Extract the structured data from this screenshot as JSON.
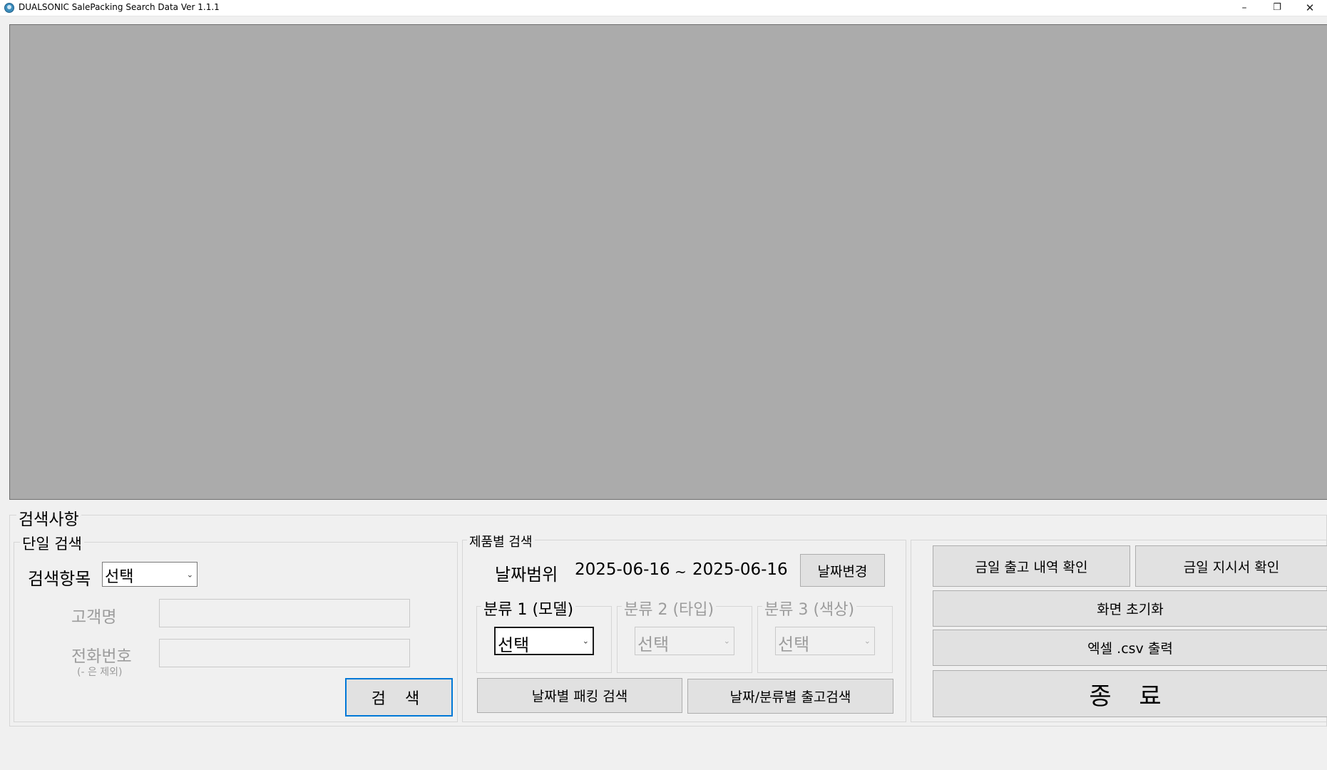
{
  "window": {
    "title": "DUALSONIC SalePacking Search Data Ver 1.1.1",
    "min_glyph": "–",
    "max_glyph": "❐",
    "close_glyph": "✕"
  },
  "search_panel": {
    "title": "검색사항",
    "single": {
      "title": "단일 검색",
      "search_item_label": "검색항목",
      "search_item_value": "선택",
      "customer_label": "고객명",
      "customer_value": "",
      "phone_label": "전화번호",
      "phone_hint": "(- 은 제외)",
      "phone_value": "",
      "search_button": "검 색"
    },
    "product": {
      "title": "제품별 검색",
      "date_range_label": "날짜범위",
      "date_start": "2025-06-16",
      "tilde": "~",
      "date_end": "2025-06-16",
      "date_change_button": "날짜변경",
      "cat1": {
        "title": "분류 1 (모델)",
        "value": "선택"
      },
      "cat2": {
        "title": "분류 2 (타입)",
        "value": "선택"
      },
      "cat3": {
        "title": "분류 3 (색상)",
        "value": "선택"
      },
      "pack_search_button": "날짜별 패킹 검색",
      "ship_search_button": "날짜/분류별 출고검색"
    },
    "actions": {
      "today_ship_button": "금일 출고 내역 확인",
      "today_order_button": "금일 지시서 확인",
      "reset_button": "화면 초기화",
      "excel_button": "엑셀 .csv 출력",
      "exit_button": "종 료"
    }
  },
  "colors": {
    "grid_background": "#ababab",
    "window_background": "#f0f0f0",
    "focus_border": "#0078d7"
  },
  "icons": {
    "app": "app-logo-icon",
    "dropdown": "chevron-down-icon"
  }
}
